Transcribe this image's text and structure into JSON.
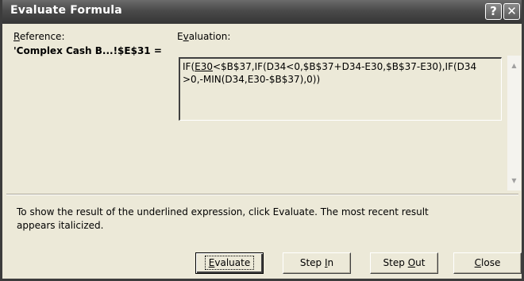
{
  "window": {
    "title": "Evaluate Formula",
    "help_glyph": "?",
    "close_glyph": "✕"
  },
  "reference": {
    "label_access": "R",
    "label_rest": "eference:",
    "value": "'Complex Cash B...!$E$31 ="
  },
  "evaluation": {
    "label_pre": "E",
    "label_access": "v",
    "label_rest": "aluation:",
    "line1_pre": "IF(",
    "line1_underlined": "E30",
    "line1_post": "<$B$37,IF(D34<0,$B$37+D34-E30,$B$37-E30),IF(D34",
    "line2": ">0,-MIN(D34,E30-$B$37),0))"
  },
  "info_text": "To show the result of the underlined expression, click Evaluate.  The most recent result appears italicized.",
  "buttons": {
    "evaluate": {
      "access": "E",
      "rest": "valuate"
    },
    "step_in": {
      "pre": "Step ",
      "access": "I",
      "rest": "n"
    },
    "step_out": {
      "pre": "Step ",
      "access": "O",
      "rest": "ut"
    },
    "close": {
      "access": "C",
      "rest": "lose"
    }
  },
  "icons": {
    "scroll_up": "scroll-up-arrow-icon",
    "scroll_down": "scroll-down-arrow-icon"
  }
}
